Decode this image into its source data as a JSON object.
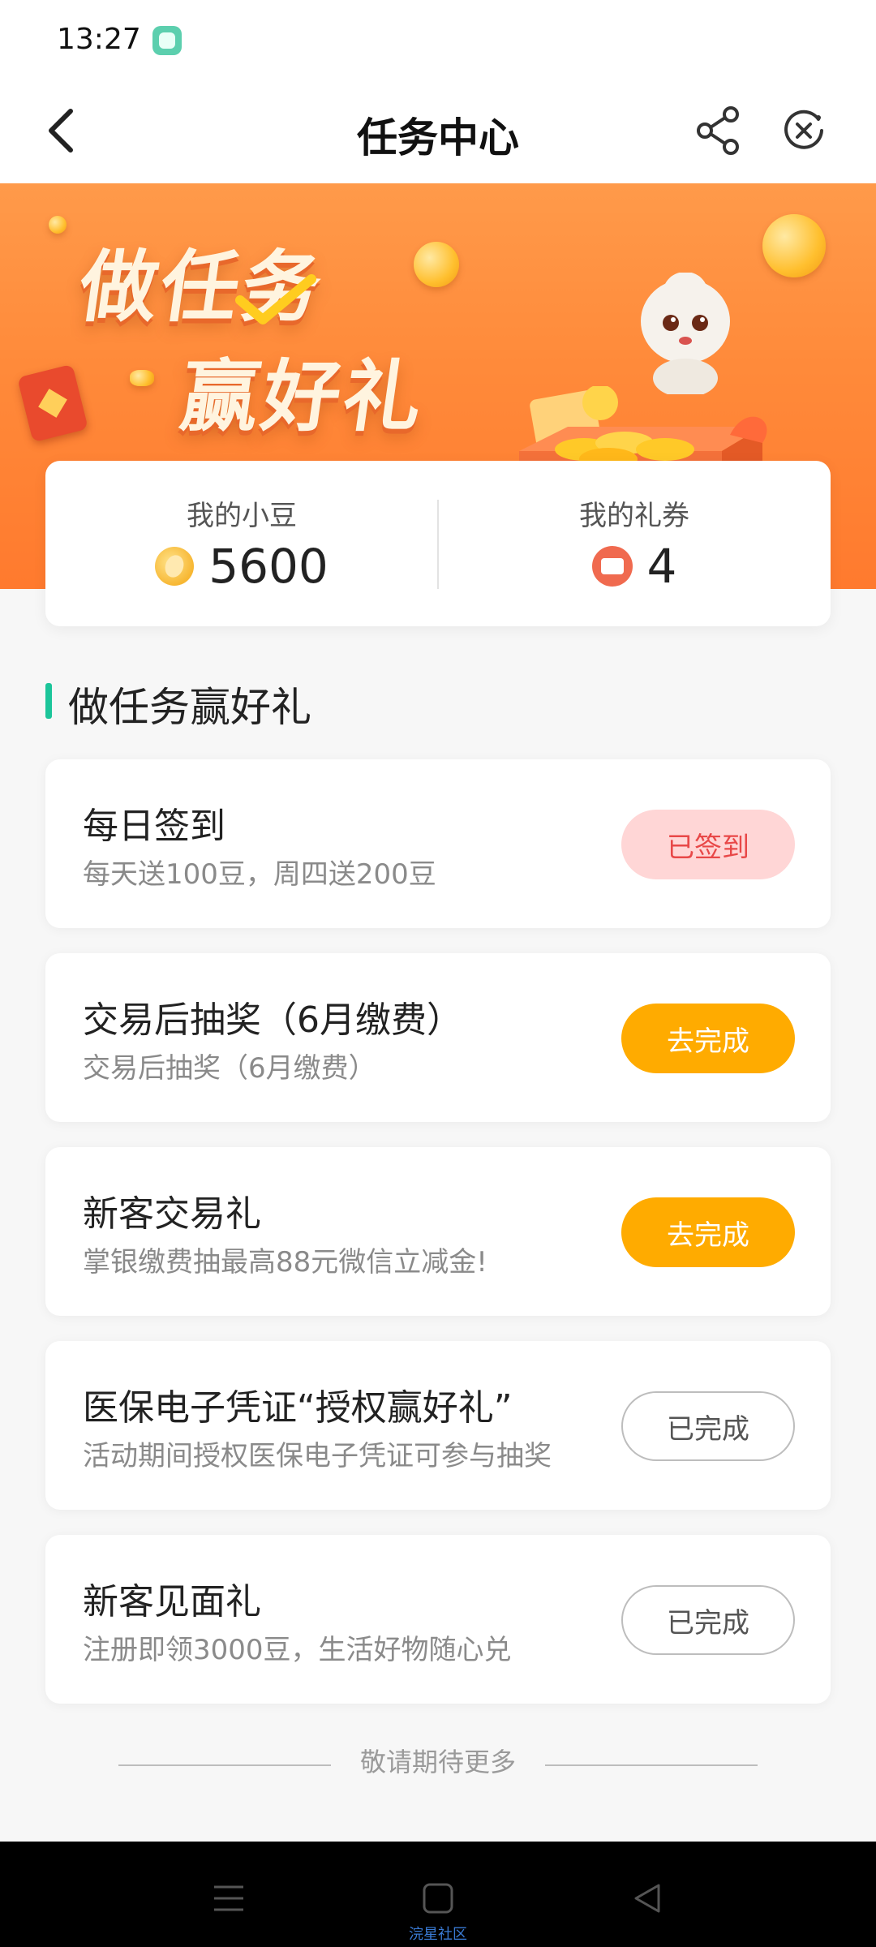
{
  "status_bar": {
    "time": "13:27"
  },
  "nav": {
    "title": "任务中心"
  },
  "banner": {
    "line1": "做任务",
    "line2": "赢好礼"
  },
  "stats": {
    "beans_label": "我的小豆",
    "beans_value": "5600",
    "coupons_label": "我的礼券",
    "coupons_value": "4"
  },
  "section": {
    "title": "做任务赢好礼"
  },
  "tasks": [
    {
      "title": "每日签到",
      "desc": "每天送100豆，周四送200豆",
      "button": "已签到",
      "state": "signed"
    },
    {
      "title": "交易后抽奖（6月缴费）",
      "desc": "交易后抽奖（6月缴费）",
      "button": "去完成",
      "state": "todo"
    },
    {
      "title": "新客交易礼",
      "desc": "掌银缴费抽最高88元微信立减金!",
      "button": "去完成",
      "state": "todo"
    },
    {
      "title": "医保电子凭证“授权赢好礼”",
      "desc": "活动期间授权医保电子凭证可参与抽奖",
      "button": "已完成",
      "state": "done"
    },
    {
      "title": "新客见面礼",
      "desc": "注册即领3000豆，生活好物随心兑",
      "button": "已完成",
      "state": "done"
    }
  ],
  "footer": {
    "text": "敬请期待更多"
  },
  "watermark": "浣星社区",
  "colors": {
    "accent_green": "#1cc59a",
    "button_orange": "#ffab00",
    "signed_red": "#e84848",
    "banner_orange": "#ff8a3a"
  }
}
